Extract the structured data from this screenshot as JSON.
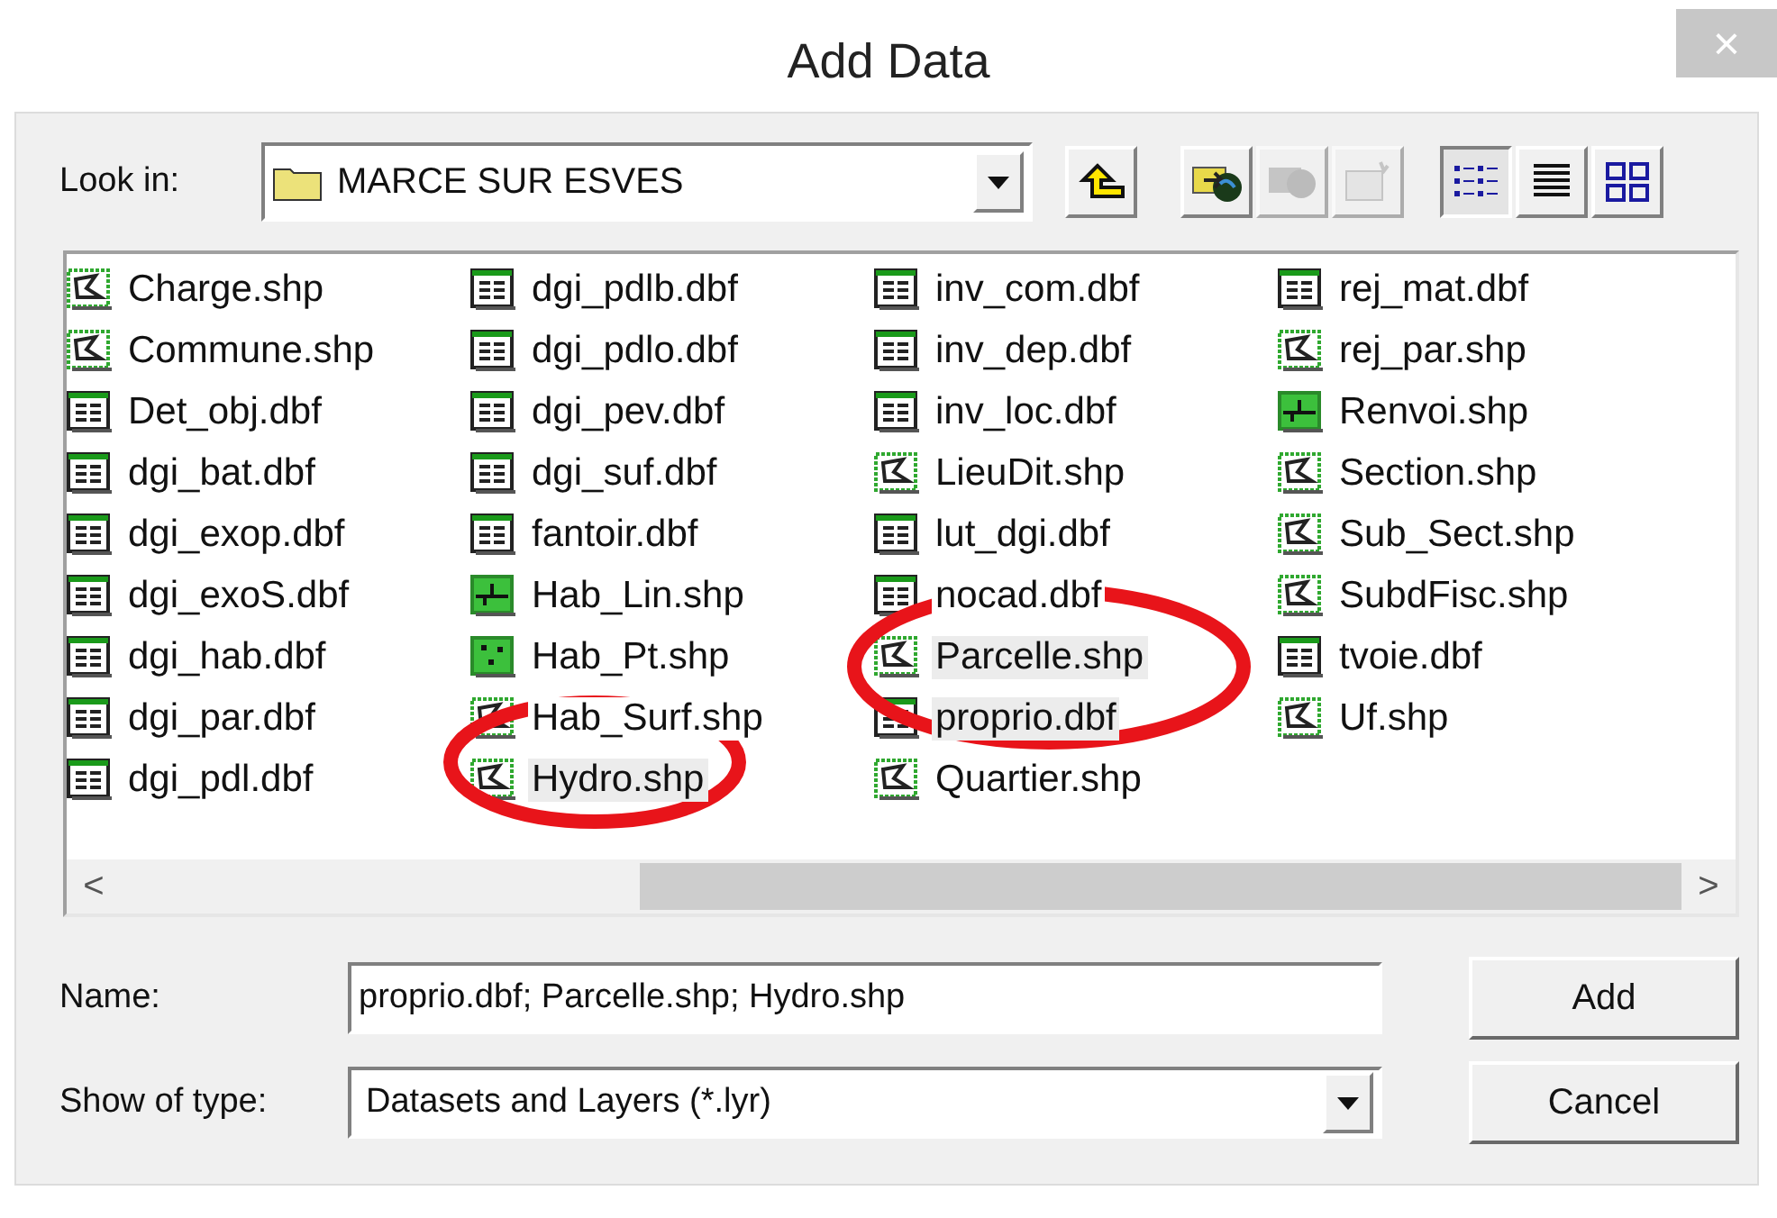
{
  "window": {
    "title": "Add Data",
    "close": "×"
  },
  "look_in": {
    "label": "Look in:",
    "value": "MARCE SUR ESVES"
  },
  "toolbar": [
    {
      "kind": "up",
      "disabled": false
    },
    {
      "kind": "connect",
      "disabled": false
    },
    {
      "kind": "disconnect",
      "disabled": true
    },
    {
      "kind": "catalog",
      "disabled": true
    }
  ],
  "views": [
    {
      "kind": "list",
      "selected": true
    },
    {
      "kind": "details",
      "selected": false
    },
    {
      "kind": "thumbnails",
      "selected": false
    }
  ],
  "files": [
    {
      "name": "Charge.shp",
      "kind": "polygon",
      "selected": false
    },
    {
      "name": "Commune.shp",
      "kind": "polygon",
      "selected": false
    },
    {
      "name": "Det_obj.dbf",
      "kind": "table",
      "selected": false
    },
    {
      "name": "dgi_bat.dbf",
      "kind": "table",
      "selected": false
    },
    {
      "name": "dgi_exop.dbf",
      "kind": "table",
      "selected": false
    },
    {
      "name": "dgi_exoS.dbf",
      "kind": "table",
      "selected": false
    },
    {
      "name": "dgi_hab.dbf",
      "kind": "table",
      "selected": false
    },
    {
      "name": "dgi_par.dbf",
      "kind": "table",
      "selected": false
    },
    {
      "name": "dgi_pdl.dbf",
      "kind": "table",
      "selected": false
    },
    {
      "name": "dgi_pdlb.dbf",
      "kind": "table",
      "selected": false
    },
    {
      "name": "dgi_pdlo.dbf",
      "kind": "table",
      "selected": false
    },
    {
      "name": "dgi_pev.dbf",
      "kind": "table",
      "selected": false
    },
    {
      "name": "dgi_suf.dbf",
      "kind": "table",
      "selected": false
    },
    {
      "name": "fantoir.dbf",
      "kind": "table",
      "selected": false
    },
    {
      "name": "Hab_Lin.shp",
      "kind": "line",
      "selected": false
    },
    {
      "name": "Hab_Pt.shp",
      "kind": "point",
      "selected": false
    },
    {
      "name": "Hab_Surf.shp",
      "kind": "polygon",
      "selected": false
    },
    {
      "name": "Hydro.shp",
      "kind": "polygon",
      "selected": true
    },
    {
      "name": "inv_com.dbf",
      "kind": "table",
      "selected": false
    },
    {
      "name": "inv_dep.dbf",
      "kind": "table",
      "selected": false
    },
    {
      "name": "inv_loc.dbf",
      "kind": "table",
      "selected": false
    },
    {
      "name": "LieuDit.shp",
      "kind": "polygon",
      "selected": false
    },
    {
      "name": "lut_dgi.dbf",
      "kind": "table",
      "selected": false
    },
    {
      "name": "nocad.dbf",
      "kind": "table",
      "selected": false
    },
    {
      "name": "Parcelle.shp",
      "kind": "polygon",
      "selected": true
    },
    {
      "name": "proprio.dbf",
      "kind": "table",
      "selected": true
    },
    {
      "name": "Quartier.shp",
      "kind": "polygon",
      "selected": false
    },
    {
      "name": "rej_mat.dbf",
      "kind": "table",
      "selected": false
    },
    {
      "name": "rej_par.shp",
      "kind": "polygon",
      "selected": false
    },
    {
      "name": "Renvoi.shp",
      "kind": "line",
      "selected": false
    },
    {
      "name": "Section.shp",
      "kind": "polygon",
      "selected": false
    },
    {
      "name": "Sub_Sect.shp",
      "kind": "polygon",
      "selected": false
    },
    {
      "name": "SubdFisc.shp",
      "kind": "polygon",
      "selected": false
    },
    {
      "name": "tvoie.dbf",
      "kind": "table",
      "selected": false
    },
    {
      "name": "Uf.shp",
      "kind": "polygon",
      "selected": false
    }
  ],
  "scrollbar": {
    "left": "<",
    "right": ">"
  },
  "name_field": {
    "label": "Name:",
    "value": "proprio.dbf; Parcelle.shp; Hydro.shp"
  },
  "type_field": {
    "label": "Show of type:",
    "value": "Datasets and Layers (*.lyr)"
  },
  "buttons": [
    "Add",
    "Cancel"
  ]
}
